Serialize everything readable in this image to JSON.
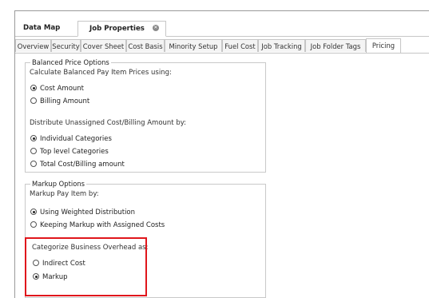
{
  "doc_tabs": [
    {
      "label": "Data Map",
      "active": false
    },
    {
      "label": "Job Properties",
      "active": true
    }
  ],
  "sub_tabs": [
    {
      "label": "Overview",
      "active": false
    },
    {
      "label": "Security",
      "active": false
    },
    {
      "label": "Cover Sheet",
      "active": false
    },
    {
      "label": "Cost Basis",
      "active": false
    },
    {
      "label": "Minority Setup",
      "active": false
    },
    {
      "label": "Fuel Cost",
      "active": false
    },
    {
      "label": "Job Tracking",
      "active": false
    },
    {
      "label": "Job Folder Tags",
      "active": false
    },
    {
      "label": "Pricing",
      "active": true
    }
  ],
  "balanced": {
    "title": "Balanced Price Options",
    "calc_label": "Calculate Balanced Pay Item Prices using:",
    "calc_options": [
      {
        "label": "Cost Amount",
        "checked": true
      },
      {
        "label": "Billing Amount",
        "checked": false
      }
    ],
    "dist_label": "Distribute Unassigned Cost/Billing Amount by:",
    "dist_options": [
      {
        "label": "Individual Categories",
        "checked": true
      },
      {
        "label": "Top level Categories",
        "checked": false
      },
      {
        "label": "Total Cost/Billing amount",
        "checked": false
      }
    ]
  },
  "markup": {
    "title": "Markup Options",
    "markup_label": "Markup Pay Item by:",
    "markup_options": [
      {
        "label": "Using Weighted Distribution",
        "checked": true
      },
      {
        "label": "Keeping Markup with Assigned Costs",
        "checked": false
      }
    ],
    "overhead_label": "Categorize Business Overhead as:",
    "overhead_options": [
      {
        "label": "Indirect Cost",
        "checked": false
      },
      {
        "label": "Markup",
        "checked": true
      }
    ]
  },
  "colors": {
    "highlight": "#e0161c",
    "border": "#c6c6c6"
  }
}
